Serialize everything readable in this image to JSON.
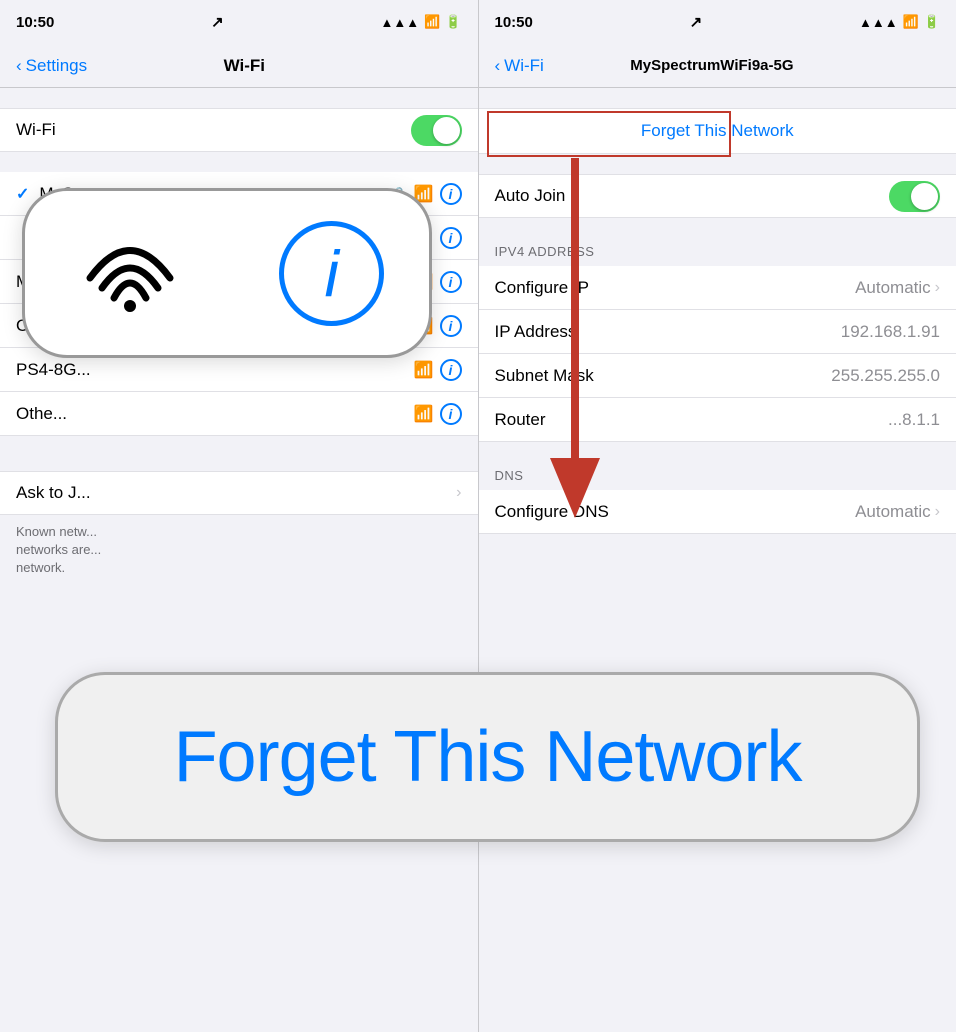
{
  "left_panel": {
    "status_bar": {
      "time": "10:50",
      "arrow": "↗",
      "signal": "▲▲▲",
      "wifi": "wifi",
      "battery": "■"
    },
    "nav": {
      "back_label": "Settings",
      "title": "Wi-Fi"
    },
    "wifi_row": {
      "label": "Wi-Fi",
      "toggle_on": true
    },
    "networks": [
      {
        "name": "MySpec...",
        "connected": true,
        "locked": true,
        "has_wifi": true,
        "has_info": true
      },
      {
        "name": "",
        "connected": false,
        "locked": false,
        "has_wifi": false,
        "has_info": true
      },
      {
        "name": "MySp...",
        "connected": false,
        "locked": true,
        "has_wifi": true,
        "has_info": true
      },
      {
        "name": "OCIREP-2G",
        "connected": false,
        "locked": false,
        "has_wifi": true,
        "has_info": true
      },
      {
        "name": "PS4-8G...",
        "connected": false,
        "locked": false,
        "has_wifi": true,
        "has_info": true
      },
      {
        "name": "Othe...",
        "connected": false,
        "locked": false,
        "has_wifi": true,
        "has_info": true
      }
    ],
    "ask_join": {
      "label": "Ask to J...",
      "value": ""
    },
    "footer": "Known netw...\nnetworks are...\nnetwork."
  },
  "right_panel": {
    "status_bar": {
      "time": "10:50",
      "arrow": "↗"
    },
    "nav": {
      "back_label": "Wi-Fi",
      "title": "MySpectrumWiFi9a-5G"
    },
    "forget_label": "Forget This Network",
    "auto_join": {
      "label": "Auto Join",
      "toggle_on": true
    },
    "ipv4_header": "IPV4 ADDRESS",
    "rows": [
      {
        "label": "Configure IP",
        "value": "Automatic",
        "has_chevron": true
      },
      {
        "label": "IP Address",
        "value": "192.168.1.91"
      },
      {
        "label": "Subnet Mask",
        "value": "255.255.255.0"
      },
      {
        "label": "Router",
        "value": "...8.1.1"
      }
    ],
    "dns_header": "DNS",
    "dns_rows": [
      {
        "label": "Configure DNS",
        "value": "Automatic",
        "has_chevron": true
      }
    ]
  },
  "overlay": {
    "forget_big_text": "Forget This Network"
  }
}
